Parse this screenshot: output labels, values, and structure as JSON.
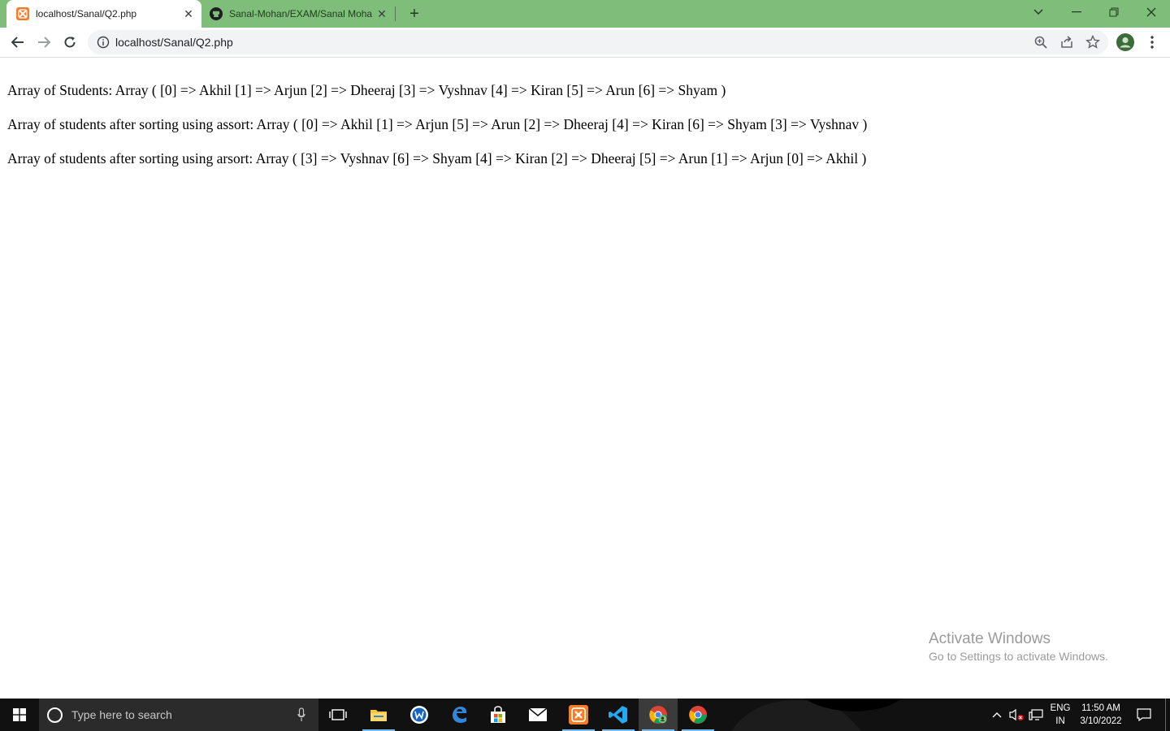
{
  "browser": {
    "tabs": [
      {
        "title": "localhost/Sanal/Q2.php",
        "favicon": "xampp-icon",
        "active": true
      },
      {
        "title": "Sanal-Mohan/EXAM/Sanal Moha",
        "favicon": "github-icon",
        "active": false
      }
    ],
    "url": "localhost/Sanal/Q2.php",
    "accent": "#7ebd7a"
  },
  "page": {
    "lines": [
      "Array of Students: Array ( [0] => Akhil [1] => Arjun [2] => Dheeraj [3] => Vyshnav [4] => Kiran [5] => Arun [6] => Shyam )",
      "Array of students after sorting using assort: Array ( [0] => Akhil [1] => Arjun [5] => Arun [2] => Dheeraj [4] => Kiran [6] => Shyam [3] => Vyshnav )",
      "Array of students after sorting using arsort: Array ( [3] => Vyshnav [6] => Shyam [4] => Kiran [2] => Dheeraj [5] => Arun [1] => Arjun [0] => Akhil )"
    ]
  },
  "watermark": {
    "title": "Activate Windows",
    "subtitle": "Go to Settings to activate Windows."
  },
  "taskbar": {
    "search_placeholder": "Type here to search",
    "apps": [
      "task-view-icon",
      "file-explorer-icon",
      "app-icon",
      "edge-icon",
      "store-icon",
      "mail-icon",
      "xampp-icon",
      "vscode-icon",
      "chrome-profile-icon",
      "chrome-icon"
    ],
    "lang_line1": "ENG",
    "lang_line2": "IN",
    "time": "11:50 AM",
    "date": "3/10/2022"
  }
}
